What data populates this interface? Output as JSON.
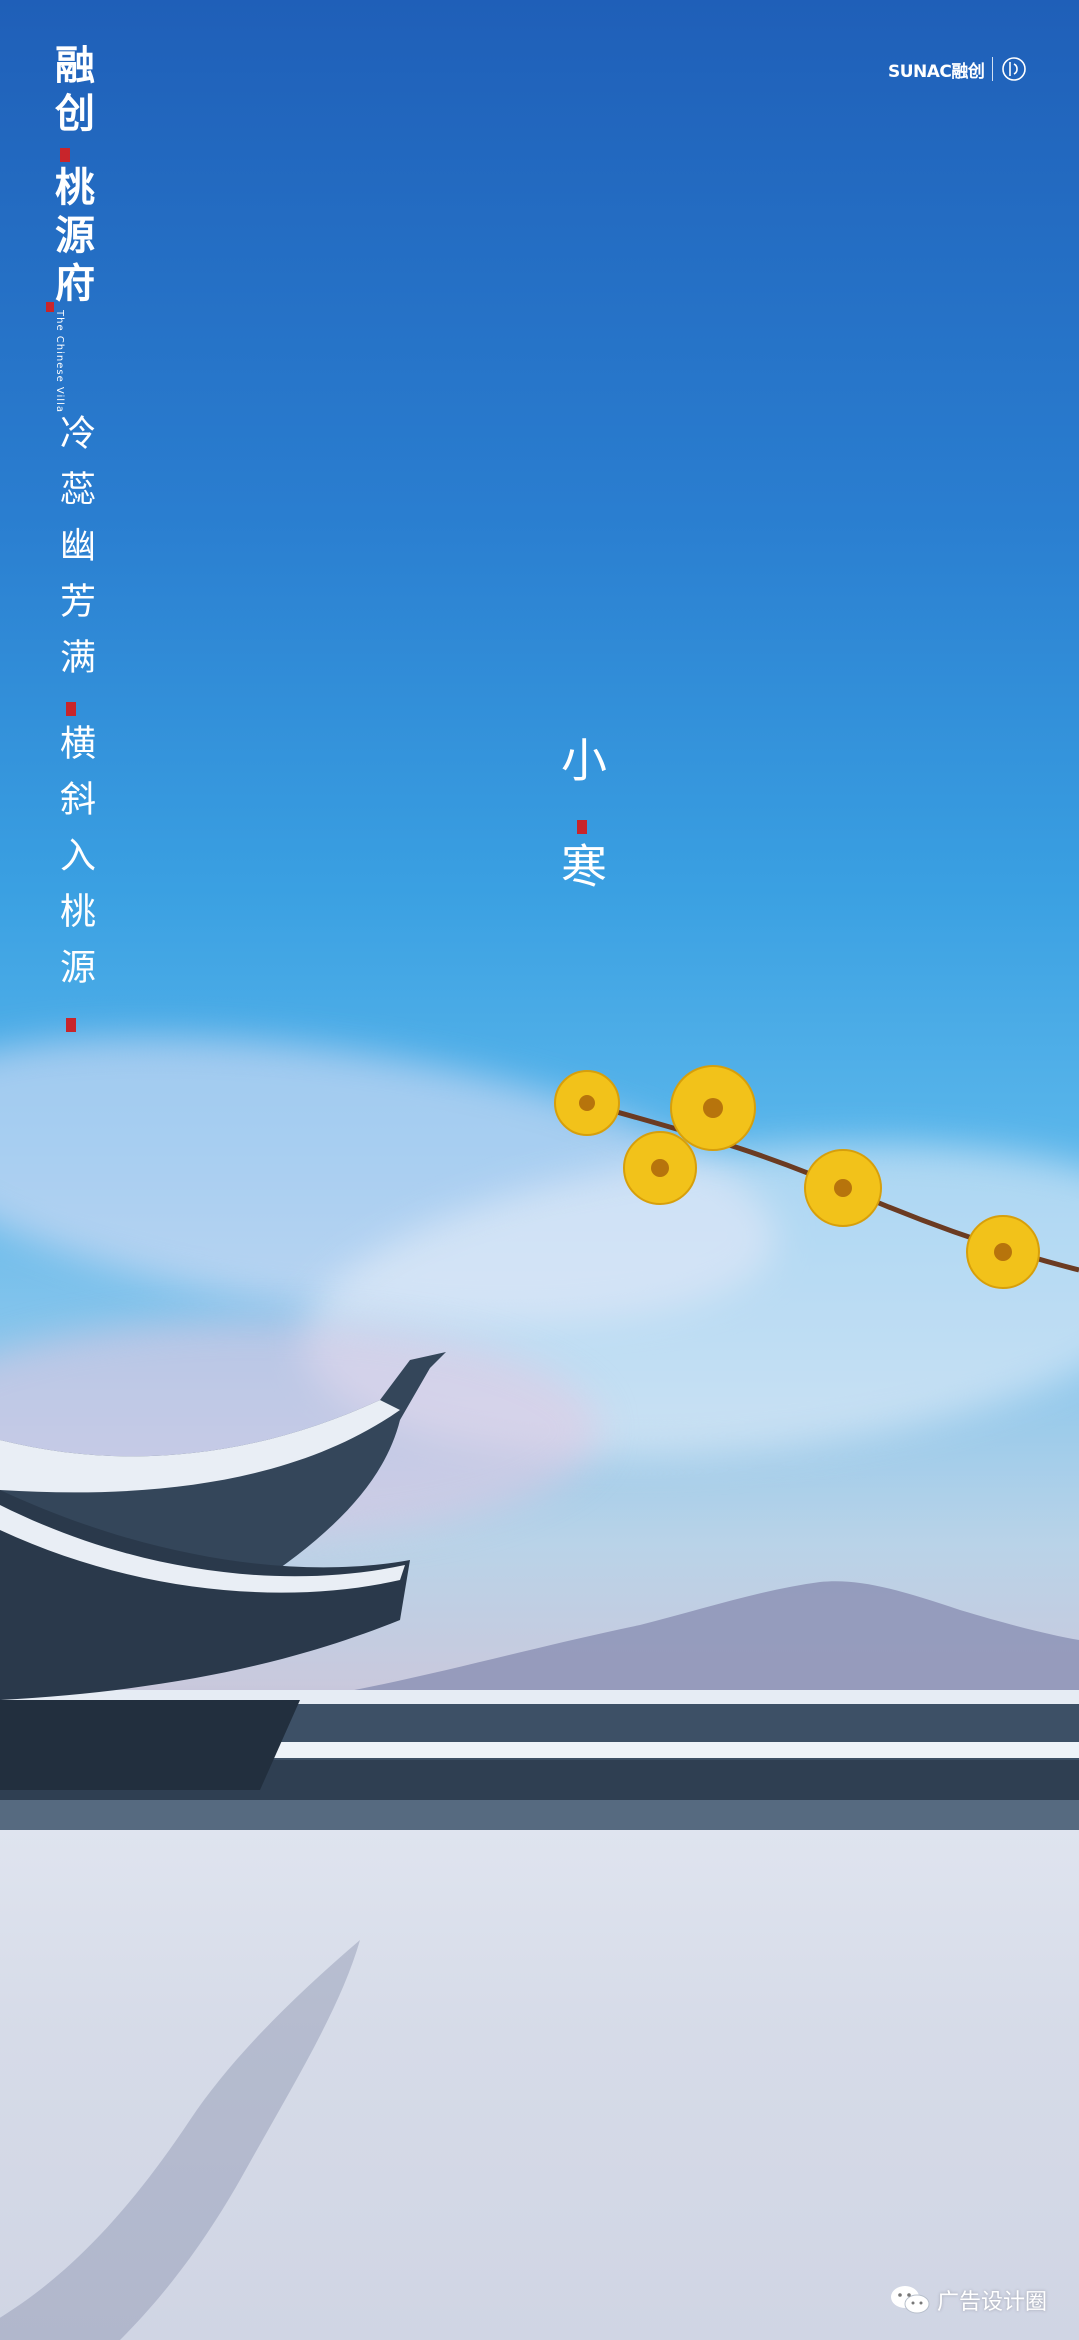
{
  "brand": {
    "line1": "融创",
    "line2": "桃源府",
    "english": "The Chinese Villa"
  },
  "poem": {
    "line1": "冷蕊幽芳满",
    "line2": "横斜入桃源"
  },
  "solar_term": "小寒",
  "logo": {
    "brand_text": "SUNAC融创",
    "icon": "taoyuanfu-seal-icon"
  },
  "watermark": {
    "icon": "wechat-icon",
    "text": "广告设计圈"
  },
  "colors": {
    "seal_red": "#c8252b",
    "blossom_yellow": "#f2c21a",
    "roof_slate": "#3c4e63"
  }
}
